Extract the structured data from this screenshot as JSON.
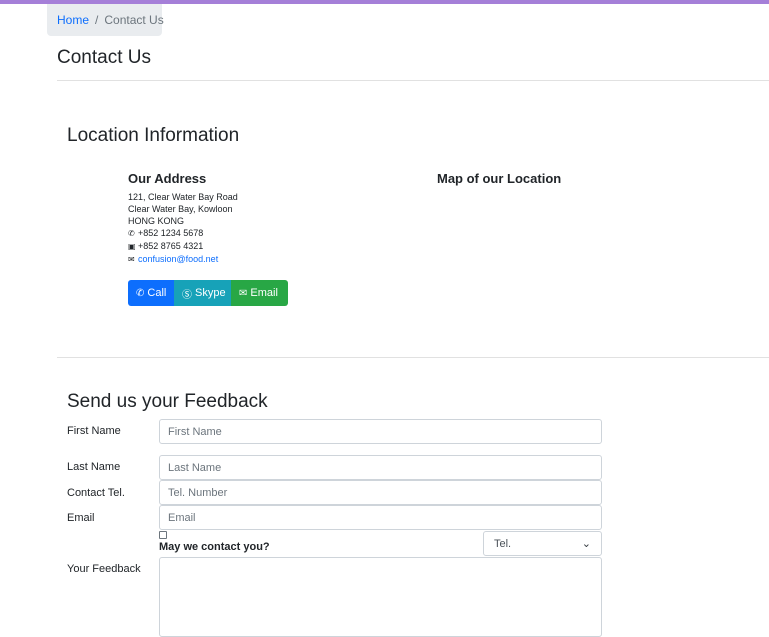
{
  "breadcrumb": {
    "home": "Home",
    "separator": "/",
    "current": "Contact Us"
  },
  "page_title": "Contact Us",
  "location": {
    "title": "Location Information",
    "address_title": "Our Address",
    "map_title": "Map of our Location",
    "address_lines": [
      "121, Clear Water Bay Road",
      "Clear Water Bay, Kowloon",
      "HONG KONG"
    ],
    "phone": "+852 1234 5678",
    "fax": "+852 8765 4321",
    "email": "confusion@food.net",
    "icons": {
      "phone": "phone-icon",
      "fax": "fax-icon",
      "email": "envelope-icon"
    }
  },
  "buttons": {
    "call": "Call",
    "skype": "Skype",
    "email": "Email"
  },
  "colors": {
    "accent_bar": "#a57fd8",
    "call": "#0d6efd",
    "skype": "#17a2b8",
    "email": "#28a745",
    "link": "#0d6efd"
  },
  "feedback": {
    "title": "Send us your Feedback",
    "first_name_label": "First Name",
    "first_name_placeholder": "First Name",
    "last_name_label": "Last Name",
    "last_name_placeholder": "Last Name",
    "tel_label": "Contact Tel.",
    "tel_placeholder": "Tel. Number",
    "email_label": "Email",
    "email_placeholder": "Email",
    "contact_question": "May we contact you?",
    "contact_method_selected": "Tel.",
    "feedback_label": "Your Feedback"
  }
}
